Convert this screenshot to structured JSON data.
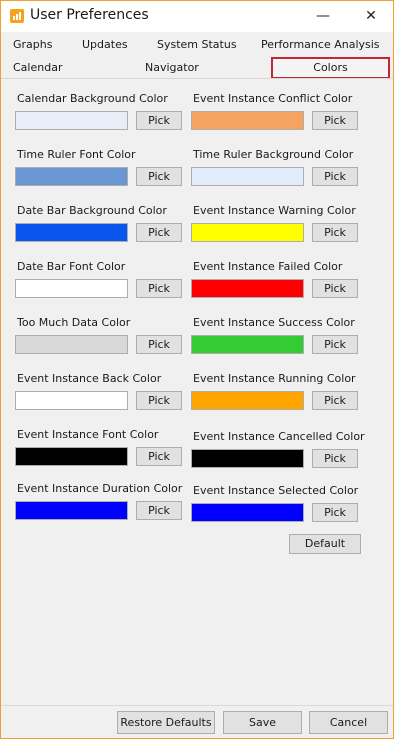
{
  "window": {
    "title": "User Preferences",
    "minimize": "—",
    "close": "✕"
  },
  "tabs": {
    "row1": [
      "Graphs",
      "Updates",
      "System Status",
      "Performance Analysis"
    ],
    "row2": [
      "Calendar",
      "Navigator",
      "Colors"
    ],
    "active": "Colors"
  },
  "pick_label": "Pick",
  "left": [
    {
      "label": "Calendar Background Color",
      "color": "#e8edf7"
    },
    {
      "label": "Time Ruler Font Color",
      "color": "#6a96d4"
    },
    {
      "label": "Date Bar Background Color",
      "color": "#0a55ee"
    },
    {
      "label": "Date Bar Font Color",
      "color": "#ffffff"
    },
    {
      "label": "Too Much Data Color",
      "color": "#d8d8d8"
    },
    {
      "label": "Event Instance Back Color",
      "color": "#ffffff"
    },
    {
      "label": "Event Instance Font Color",
      "color": "#000000"
    },
    {
      "label": "Event Instance Duration Color",
      "color": "#0000ff"
    }
  ],
  "right": [
    {
      "label": "Event Instance Conflict Color",
      "color": "#f4a460"
    },
    {
      "label": "Time Ruler Background Color",
      "color": "#e0ecfb"
    },
    {
      "label": "Event Instance Warning Color",
      "color": "#ffff00"
    },
    {
      "label": "Event Instance Failed Color",
      "color": "#ff0000"
    },
    {
      "label": "Event Instance Success Color",
      "color": "#33cc33"
    },
    {
      "label": "Event Instance Running Color",
      "color": "#ffa500"
    },
    {
      "label": "Event Instance Cancelled Color",
      "color": "#000000"
    },
    {
      "label": "Event Instance Selected Color",
      "color": "#0000ff"
    }
  ],
  "default_label": "Default",
  "footer": {
    "restore": "Restore Defaults",
    "save": "Save",
    "cancel": "Cancel"
  }
}
